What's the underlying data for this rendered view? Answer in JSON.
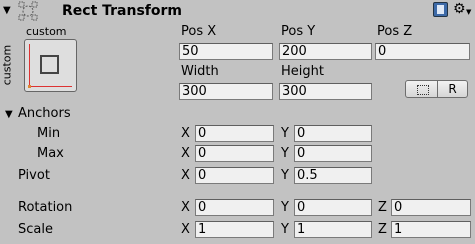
{
  "header": {
    "title": "Rect Transform",
    "icons": {
      "left": "transform-gizmo-icon",
      "book": "help-book-icon",
      "gear": "gear-icon"
    }
  },
  "anchor_preset": {
    "top_label": "custom",
    "side_label": "custom"
  },
  "columns": {
    "pos_x": "Pos X",
    "pos_y": "Pos Y",
    "pos_z": "Pos Z",
    "width": "Width",
    "height": "Height"
  },
  "values": {
    "pos_x": "50",
    "pos_y": "200",
    "pos_z": "0",
    "width": "300",
    "height": "300"
  },
  "buttons": {
    "blueprint": "[ ]",
    "raw": "R"
  },
  "anchors": {
    "label": "Anchors",
    "min": {
      "label": "Min",
      "x": "0",
      "y": "0"
    },
    "max": {
      "label": "Max",
      "x": "0",
      "y": "0"
    }
  },
  "pivot": {
    "label": "Pivot",
    "x": "0",
    "y": "0.5"
  },
  "rotation": {
    "label": "Rotation",
    "x": "0",
    "y": "0",
    "z": "0"
  },
  "scale": {
    "label": "Scale",
    "x": "1",
    "y": "1",
    "z": "1"
  },
  "axes": {
    "x": "X",
    "y": "Y",
    "z": "Z"
  }
}
